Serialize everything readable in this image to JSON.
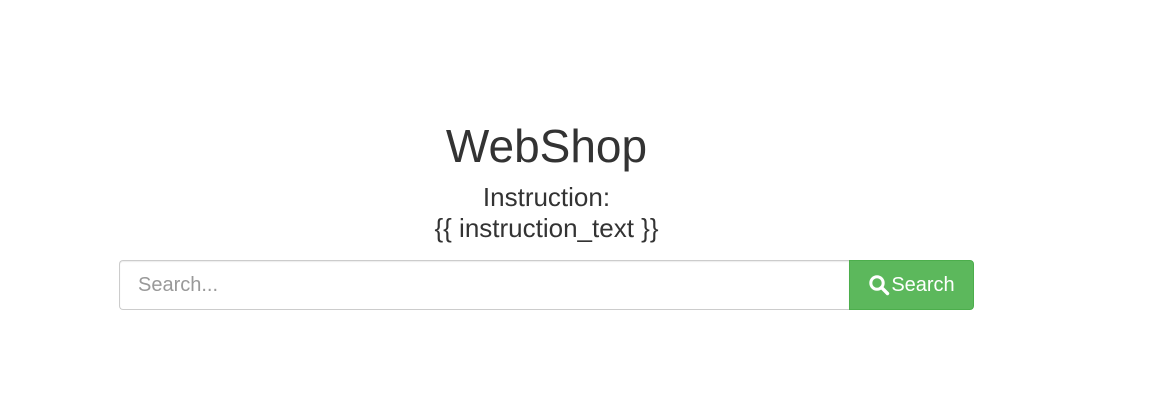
{
  "header": {
    "title": "WebShop"
  },
  "instruction": {
    "label": "Instruction:",
    "text": "{{ instruction_text }}"
  },
  "search": {
    "placeholder": "Search...",
    "value": "",
    "button_label": "Search",
    "button_icon": "search-icon"
  },
  "colors": {
    "button_bg": "#5cb85c",
    "text": "#333333"
  }
}
